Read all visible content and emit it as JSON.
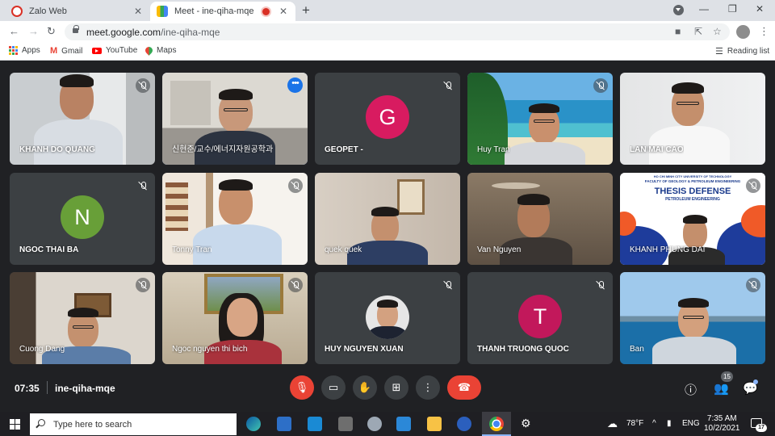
{
  "browser": {
    "tabs": [
      {
        "title": "Zalo Web",
        "icon": "zalo-icon",
        "active": false
      },
      {
        "title": "Meet - ine-qiha-mqe",
        "icon": "google-meet-icon",
        "active": true,
        "recording": true
      }
    ],
    "new_tab_label": "+",
    "url_host": "meet.google.com",
    "url_path": "/ine-qiha-mqe",
    "bookmarks": [
      {
        "label": "Apps",
        "icon": "apps-grid-icon"
      },
      {
        "label": "Gmail",
        "icon": "gmail-icon"
      },
      {
        "label": "YouTube",
        "icon": "youtube-icon"
      },
      {
        "label": "Maps",
        "icon": "maps-icon"
      }
    ],
    "reading_list": "Reading list"
  },
  "meeting": {
    "time": "07:35",
    "code": "ine-qiha-mqe",
    "participant_count": "15",
    "tiles": [
      {
        "name": "KHANH DO QUANG",
        "type": "video",
        "muted": true
      },
      {
        "name": "신현준/교수/에너지자원공학과",
        "type": "video",
        "muted": false,
        "speaking": true
      },
      {
        "name": "GEOPET -",
        "type": "avatar",
        "initial": "G",
        "color": "#d81b60",
        "muted": true
      },
      {
        "name": "Huy Tran",
        "type": "video",
        "muted": true
      },
      {
        "name": "LAN MAI CAO",
        "type": "video",
        "muted": false
      },
      {
        "name": "NGOC THAI BA",
        "type": "avatar",
        "initial": "N",
        "color": "#689f38",
        "muted": true
      },
      {
        "name": "Tonny Tran",
        "type": "video",
        "muted": true
      },
      {
        "name": "quek quek",
        "type": "video",
        "muted": false
      },
      {
        "name": "Van Nguyen",
        "type": "video",
        "muted": false
      },
      {
        "name": "KHANH PHUNG DAI",
        "type": "video",
        "muted": true
      },
      {
        "name": "Cuong Dang",
        "type": "video",
        "muted": true
      },
      {
        "name": "Ngoc nguyen thi bich",
        "type": "video",
        "muted": true
      },
      {
        "name": "HUY NGUYEN XUAN",
        "type": "photo",
        "muted": true
      },
      {
        "name": "THANH TRUONG QUOC",
        "type": "avatar",
        "initial": "T",
        "color": "#c2185b",
        "muted": true
      },
      {
        "name": "Ban",
        "type": "video",
        "muted": true
      }
    ],
    "slide": {
      "university": "HO CHI MINH CITY UNIVERSITY OF TECHNOLOGY",
      "faculty": "FACULTY OF GEOLOGY & PETROLEUM ENGINEERING",
      "title": "THESIS DEFENSE",
      "subtitle": "PETROLEUM ENGINEERING"
    },
    "controls": [
      {
        "name": "mic-toggle",
        "icon": "mic-off-icon"
      },
      {
        "name": "camera-toggle",
        "icon": "camera-icon"
      },
      {
        "name": "raise-hand",
        "icon": "hand-icon"
      },
      {
        "name": "present-now",
        "icon": "present-icon"
      },
      {
        "name": "more-options",
        "icon": "more-vert-icon"
      },
      {
        "name": "leave-call",
        "icon": "phone-hangup-icon"
      }
    ]
  },
  "taskbar": {
    "search_placeholder": "Type here to search",
    "weather": "78°F",
    "language": "ENG",
    "clock_time": "7:35 AM",
    "clock_date": "10/2/2021",
    "notifications": "17"
  },
  "colors": {
    "meet_bg": "#202124",
    "tile_bg": "#3c4043",
    "leave_red": "#ea4335",
    "speaking_outline": "#8ab4f8"
  }
}
